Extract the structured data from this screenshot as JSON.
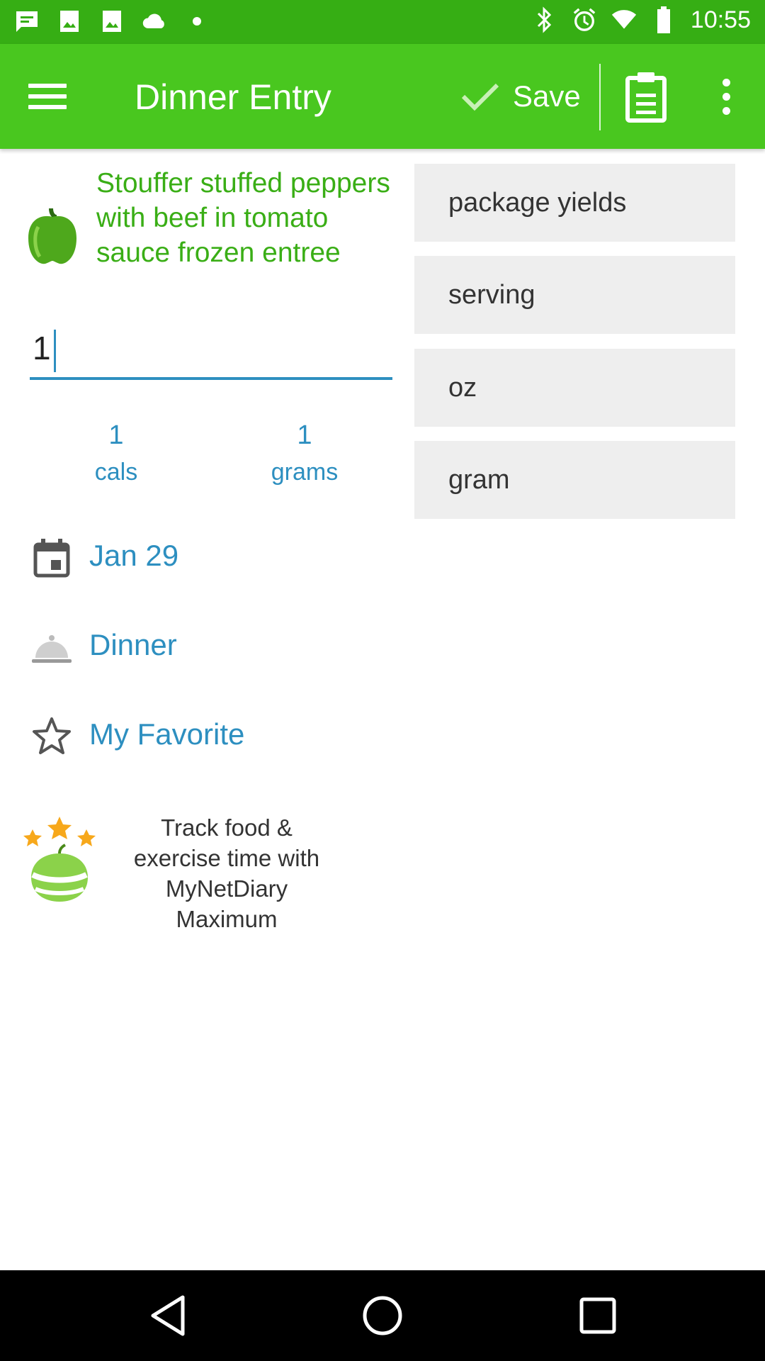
{
  "status_bar": {
    "time": "10:55",
    "icons": [
      "chat-icon",
      "image-icon",
      "image-icon",
      "cloud-icon",
      "dot-icon",
      "bluetooth-icon",
      "alarm-icon",
      "wifi-icon",
      "battery-icon"
    ]
  },
  "app_bar": {
    "title": "Dinner Entry",
    "save_label": "Save",
    "menu_icon": "menu-icon",
    "clipboard_icon": "clipboard-icon",
    "more_icon": "more-vert-icon"
  },
  "food": {
    "name": "Stouffer stuffed peppers with beef in tomato sauce frozen entree",
    "icon": "pepper-icon"
  },
  "quantity": {
    "value": "1"
  },
  "stats": [
    {
      "value": "1",
      "label": "cals"
    },
    {
      "value": "1",
      "label": "grams"
    }
  ],
  "units": [
    "package yields",
    "serving",
    "oz",
    "gram"
  ],
  "details": {
    "date": "Jan 29",
    "meal": "Dinner",
    "favorite": "My Favorite"
  },
  "promo": {
    "text": "Track food & exercise time with MyNetDiary Maximum"
  },
  "colors": {
    "status_bar": "#36ae14",
    "app_bar": "#49c71f",
    "link_blue": "#2d8fc0",
    "food_green": "#3aae16",
    "option_bg": "#eeeeee"
  }
}
